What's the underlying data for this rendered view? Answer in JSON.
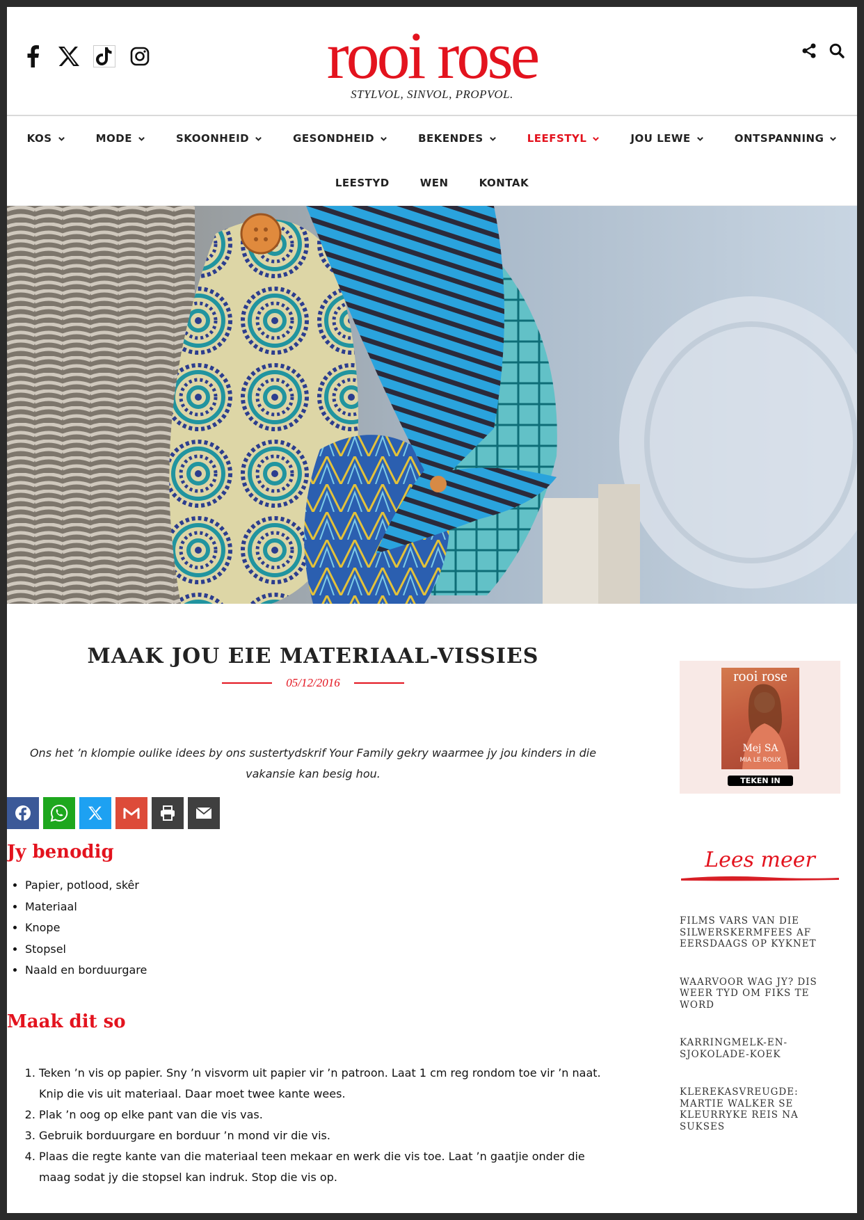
{
  "site": {
    "logo": "rooi rose",
    "tagline": "STYLVOL, SINVOL, PROPVOL."
  },
  "nav": {
    "row1": [
      {
        "label": "KOS",
        "active": false
      },
      {
        "label": "MODE",
        "active": false
      },
      {
        "label": "SKOONHEID",
        "active": false
      },
      {
        "label": "GESONDHEID",
        "active": false
      },
      {
        "label": "BEKENDES",
        "active": false
      },
      {
        "label": "LEEFSTYL",
        "active": true
      },
      {
        "label": "JOU LEWE",
        "active": false
      },
      {
        "label": "ONTSPANNING",
        "active": false
      }
    ],
    "row2": [
      {
        "label": "LEESTYD"
      },
      {
        "label": "WEN"
      },
      {
        "label": "KONTAK"
      }
    ]
  },
  "article": {
    "title": "MAAK JOU EIE MATERIAAL-VISSIES",
    "date": "05/12/2016",
    "intro": "Ons het ’n klompie oulike idees by ons sustertydskrif Your Family gekry waarmee jy jou kinders in die vakansie kan besig hou.",
    "needs_heading": "Jy benodig",
    "needs": [
      "Papier, potlood, skêr",
      "Materiaal",
      "Knope",
      "Stopsel",
      "Naald en borduurgare"
    ],
    "steps_heading": "Maak dit so",
    "steps": [
      "Teken ’n vis op papier. Sny ’n visvorm uit papier vir ’n patroon. Laat 1 cm reg rondom toe vir ’n naat. Knip die vis uit materiaal. Daar moet twee kante wees.",
      "Plak ’n oog op elke pant van die vis vas.",
      "Gebruik borduurgare en borduur ’n mond vir die vis.",
      "Plaas die regte kante van die materiaal teen mekaar en werk die vis toe. Laat ’n gaatjie onder die maag sodat jy die stopsel kan indruk. Stop die vis op."
    ]
  },
  "share_buttons": [
    {
      "name": "facebook",
      "color": "#3b5998"
    },
    {
      "name": "whatsapp",
      "color": "#1ea71e"
    },
    {
      "name": "x",
      "color": "#1da1f2"
    },
    {
      "name": "gmail",
      "color": "#dd4b39"
    },
    {
      "name": "print",
      "color": "#3f3f3f"
    },
    {
      "name": "email",
      "color": "#3f3f3f"
    }
  ],
  "sidebar": {
    "magazine": {
      "logo": "rooi rose",
      "cover_line": "Mej SA",
      "cover_sub": "MIA LE ROUX",
      "cta": "TEKEN IN"
    },
    "lees_meer_title": "Lees meer",
    "lees_meer": [
      "FILMS VARS VAN DIE SILWERSKERMFEES AF EERSDAAGS OP KYKNET",
      "WAARVOOR WAG JY? DIS WEER TYD OM FIKS TE WORD",
      "KARRINGMELK-EN-SJOKOLADE-KOEK",
      "KLEREKASVREUGDE: MARTIE WALKER SE KLEURRYKE REIS NA SUKSES"
    ]
  },
  "colors": {
    "brand_red": "#e3131e",
    "promo_bg": "#f8e9e6"
  }
}
